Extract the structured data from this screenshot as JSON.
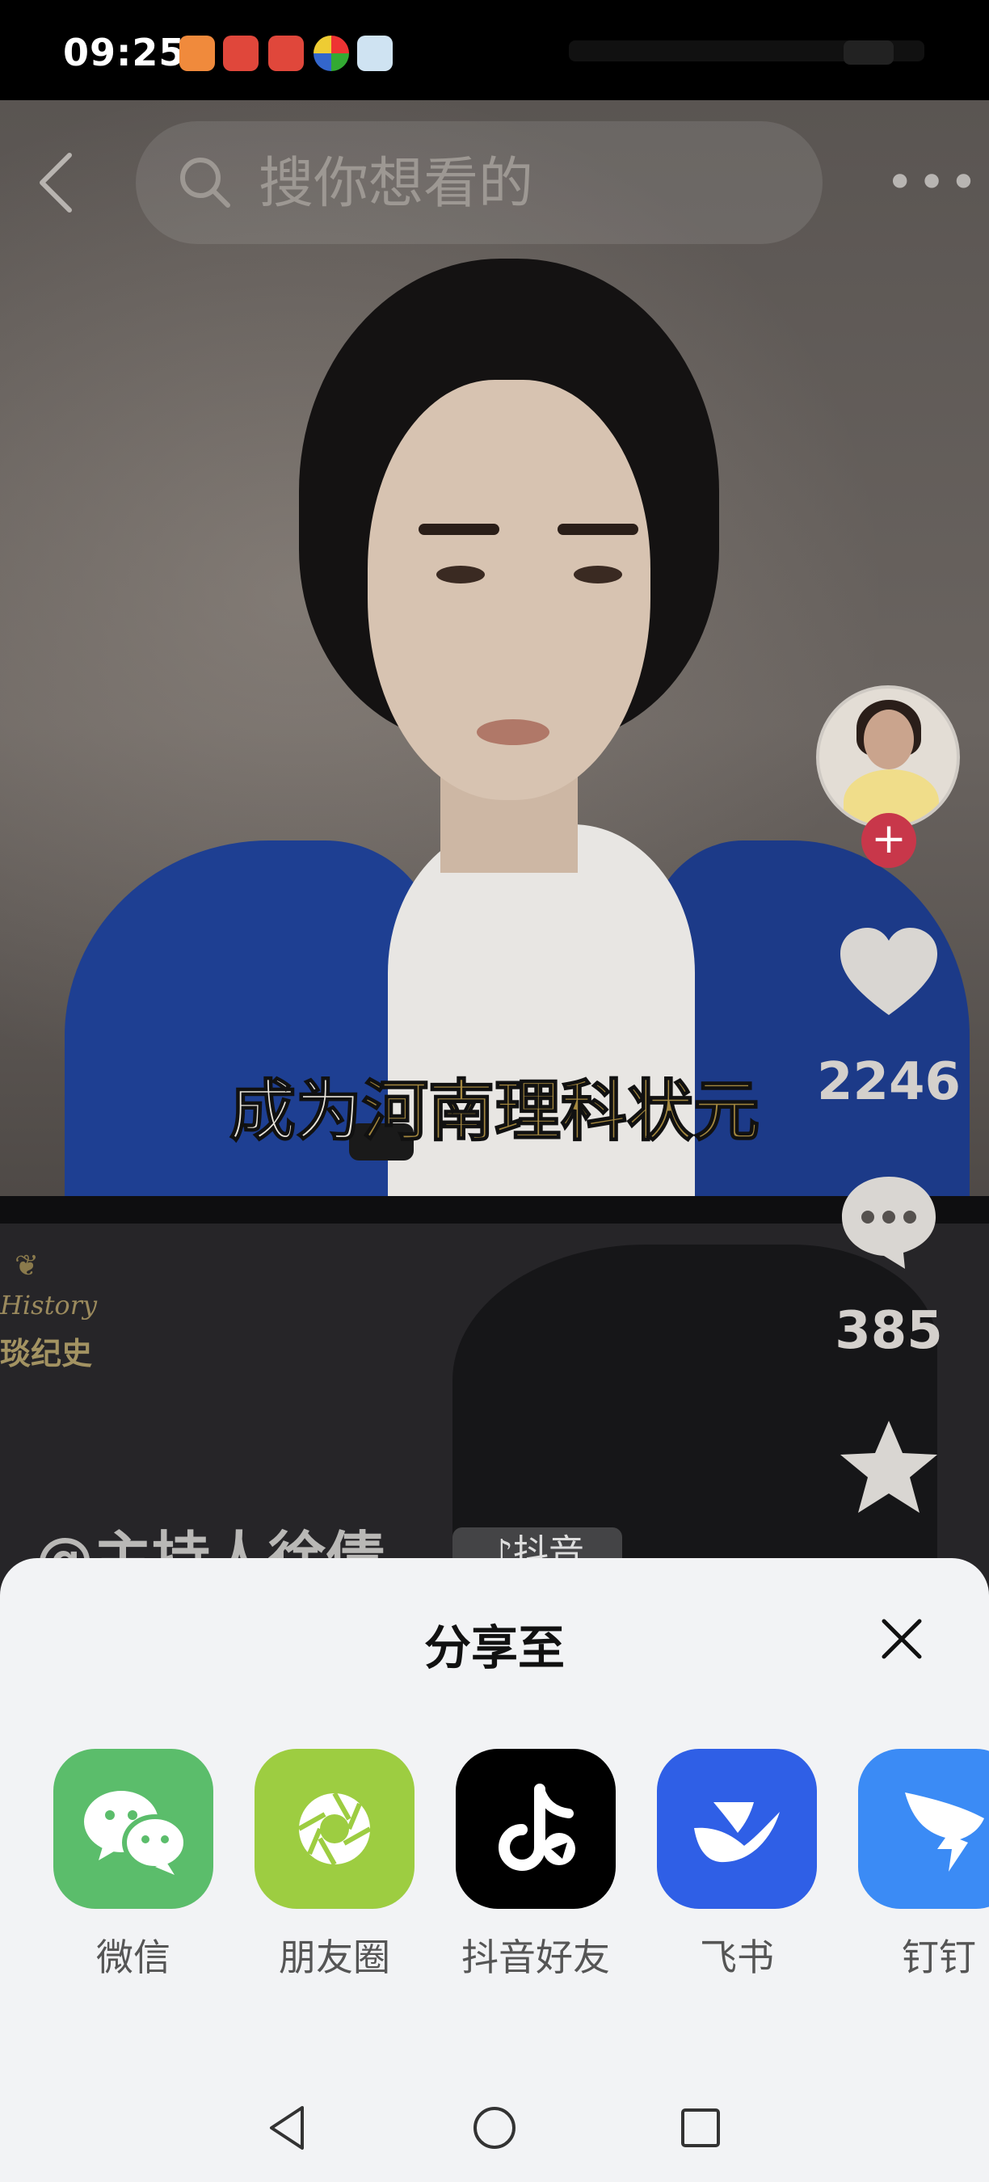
{
  "status_bar": {
    "time": "09:25"
  },
  "top_bar": {
    "search_placeholder": "搜你想看的"
  },
  "video": {
    "subtitle_part1": "成为",
    "subtitle_part2": "河南理科状元",
    "watermark_en": "History",
    "watermark_cn": "琰纪史",
    "author": "@主持人徐倩",
    "author_tag": "抖音"
  },
  "rail": {
    "like_count": "2246",
    "comment_count": "385"
  },
  "share_sheet": {
    "title": "分享至",
    "targets": [
      {
        "label": "微信",
        "color": "#5bbd6b",
        "icon": "wechat-icon"
      },
      {
        "label": "朋友圈",
        "color": "#9dcd41",
        "icon": "moments-icon"
      },
      {
        "label": "抖音好友",
        "color": "#000000",
        "icon": "douyin-icon"
      },
      {
        "label": "飞书",
        "color": "#2f5fe6",
        "icon": "feishu-icon"
      },
      {
        "label": "钉钉",
        "color": "#3b8bf5",
        "icon": "dingtalk-icon"
      }
    ]
  }
}
